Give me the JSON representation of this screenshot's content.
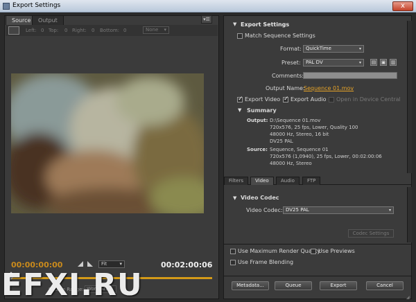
{
  "window": {
    "title": "Export Settings",
    "close_label": "x"
  },
  "source_panel": {
    "tabs": [
      "Source",
      "Output"
    ],
    "menu_label": "▾☰",
    "crop": {
      "left_label": "Left:",
      "left": "0",
      "top_label": "Top:",
      "top": "0",
      "right_label": "Right:",
      "right": "0",
      "bottom_label": "Bottom:",
      "bottom": "0",
      "ratio": "None"
    },
    "timecode_start": "00:00:00:00",
    "timecode_end": "00:02:00:06",
    "zoom": "Fit",
    "source_range_label": "Source Range:",
    "source_range": "Work Area",
    "watermark": "EFXI.RU"
  },
  "export_settings": {
    "header": "Export Settings",
    "match_sequence_label": "Match Sequence Settings",
    "format_label": "Format:",
    "format": "QuickTime",
    "preset_label": "Preset:",
    "preset": "PAL DV",
    "comments_label": "Comments:",
    "output_name_label": "Output Name:",
    "output_name": "Sequence 01.mov",
    "export_video_label": "Export Video",
    "export_audio_label": "Export Audio",
    "open_device_label": "Open in Device Central",
    "summary": {
      "header": "Summary",
      "output_label": "Output:",
      "output_lines": [
        "D:\\Sequence 01.mov",
        "720x576, 25 fps, Lower, Quality 100",
        "48000 Hz, Stereo, 16 bit",
        "DV25 PAL"
      ],
      "source_label": "Source:",
      "source_lines": [
        "Sequence, Sequence 01",
        "720x576 (1,0940), 25 fps, Lower, 00:02:00:06",
        "48000 Hz, Stereo"
      ]
    }
  },
  "settings_tabs": [
    "Filters",
    "Video",
    "Audio",
    "FTP"
  ],
  "video_codec": {
    "header": "Video Codec",
    "codec_label": "Video Codec:",
    "codec": "DV25 PAL",
    "settings_button": "Codec Settings"
  },
  "options": {
    "max_render_quality": "Use Maximum Render Quality",
    "use_previews": "Use Previews",
    "frame_blending": "Use Frame Blending"
  },
  "buttons": {
    "metadata": "Metadata...",
    "queue": "Queue",
    "export": "Export",
    "cancel": "Cancel"
  },
  "colors": {
    "accent": "#e6a328",
    "panel": "#3b3b3b",
    "timecode": "#c98a1c"
  }
}
